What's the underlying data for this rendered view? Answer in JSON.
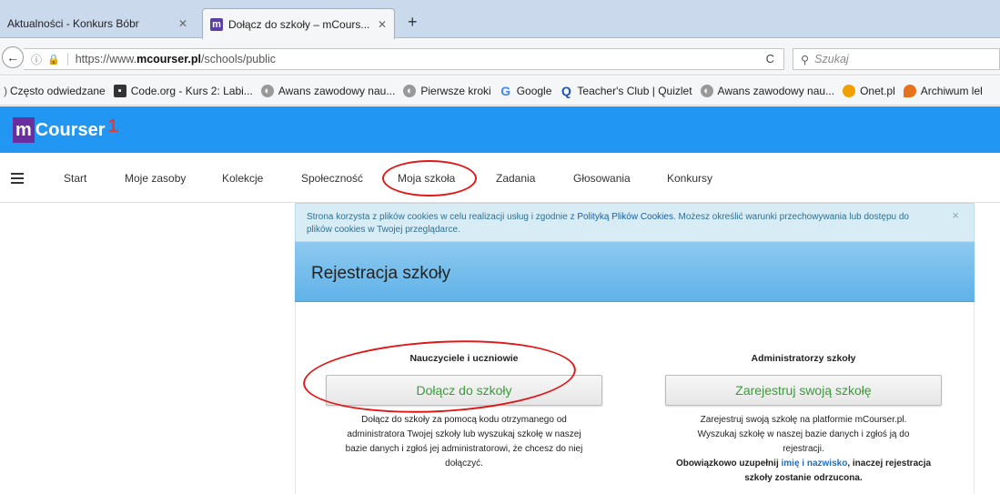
{
  "browser": {
    "tabs": [
      {
        "label": "Aktualności - Konkurs Bóbr"
      },
      {
        "label": "Dołącz do szkoły – mCours...",
        "favicon": "m"
      }
    ],
    "new_tab": "+",
    "url_prefix": "https://www.",
    "url_domain": "mcourser.pl",
    "url_path": "/schools/public",
    "search_placeholder": "Szukaj",
    "bookmarks": [
      "Często odwiedzane",
      "Code.org - Kurs 2: Labi...",
      "Awans zawodowy nau...",
      "Pierwsze kroki",
      "Google",
      "Teacher's Club | Quizlet",
      "Awans zawodowy nau...",
      "Onet.pl",
      "Archiwum lel"
    ]
  },
  "app": {
    "logo_m": "m",
    "logo_rest": "Courser",
    "logo_mark": "1",
    "nav": [
      "Start",
      "Moje zasoby",
      "Kolekcje",
      "Społeczność",
      "Moja szkoła",
      "Zadania",
      "Głosowania",
      "Konkursy"
    ]
  },
  "cookie": {
    "text1": "Strona korzysta z plików cookies w celu realizacji usług i zgodnie z ",
    "link": "Polityką Plików Cookies",
    "text2": ". Możesz określić warunki przechowywania lub dostępu do plików cookies w Twojej przeglądarce.",
    "close": "×"
  },
  "panel": {
    "title": "Rejestracja szkoły",
    "left": {
      "heading": "Nauczyciele i uczniowie",
      "button": "Dołącz do szkoły",
      "desc": "Dołącz do szkoły za pomocą kodu otrzymanego od administratora Twojej szkoły lub wyszukaj szkołę w naszej bazie danych i zgłoś jej administratorowi, że chcesz do niej dołączyć."
    },
    "right": {
      "heading": "Administratorzy szkoły",
      "button": "Zarejestruj swoją szkołę",
      "desc": "Zarejestruj swoją szkołę na platformie mCourser.pl. Wyszukaj szkołę w naszej bazie danych i zgłoś ją do rejestracji.",
      "note_prefix": "Obowiązkowo uzupełnij ",
      "note_link": "imię i nazwisko",
      "note_suffix": ", inaczej rejestracja szkoły zostanie odrzucona."
    }
  },
  "colors": {
    "header_blue": "#2196f3",
    "button_text": "#3a9a3a",
    "annotation_red": "#e01818"
  }
}
